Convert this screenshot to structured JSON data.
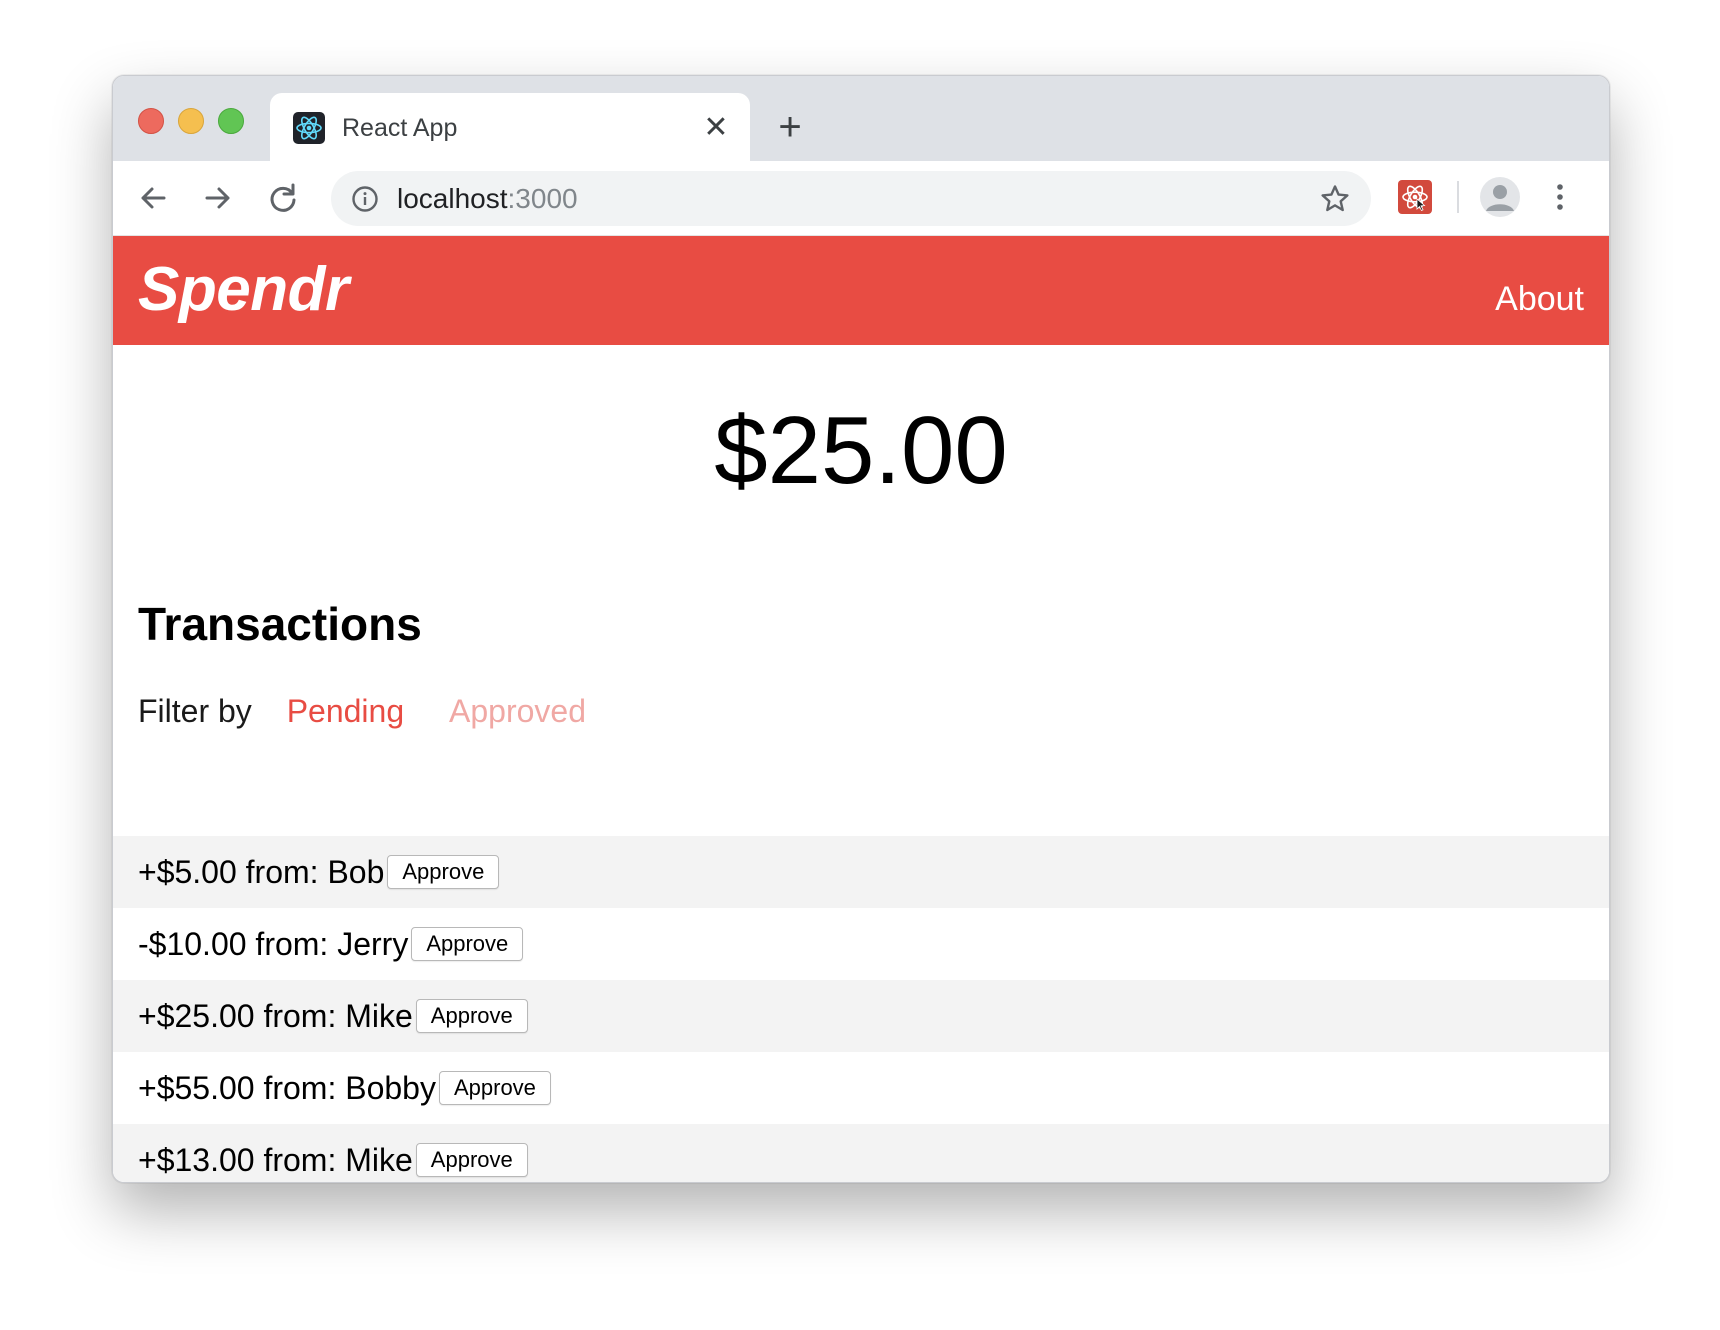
{
  "browser": {
    "tab_title": "React App",
    "url_host": "localhost",
    "url_port": ":3000"
  },
  "app": {
    "brand": "Spendr",
    "nav_about": "About",
    "brand_color": "#e84c43",
    "balance": "$25.00",
    "transactions_heading": "Transactions",
    "filter": {
      "label": "Filter by",
      "options": [
        "Pending",
        "Approved"
      ],
      "active": "Pending"
    },
    "transactions": [
      {
        "text": "+$5.00 from: Bob",
        "action": "Approve"
      },
      {
        "text": "-$10.00 from: Jerry",
        "action": "Approve"
      },
      {
        "text": "+$25.00 from: Mike",
        "action": "Approve"
      },
      {
        "text": "+$55.00 from: Bobby",
        "action": "Approve"
      },
      {
        "text": "+$13.00 from: Mike",
        "action": "Approve"
      }
    ]
  },
  "icons": {
    "tab_favicon": "react-logo-icon",
    "tab_close": "close-icon",
    "new_tab": "plus-icon",
    "back": "arrow-left-icon",
    "forward": "arrow-right-icon",
    "reload": "reload-icon",
    "site_info": "info-icon",
    "bookmark": "star-icon",
    "extension": "react-devtools-icon",
    "profile": "avatar-icon",
    "menu": "kebab-menu-icon"
  }
}
